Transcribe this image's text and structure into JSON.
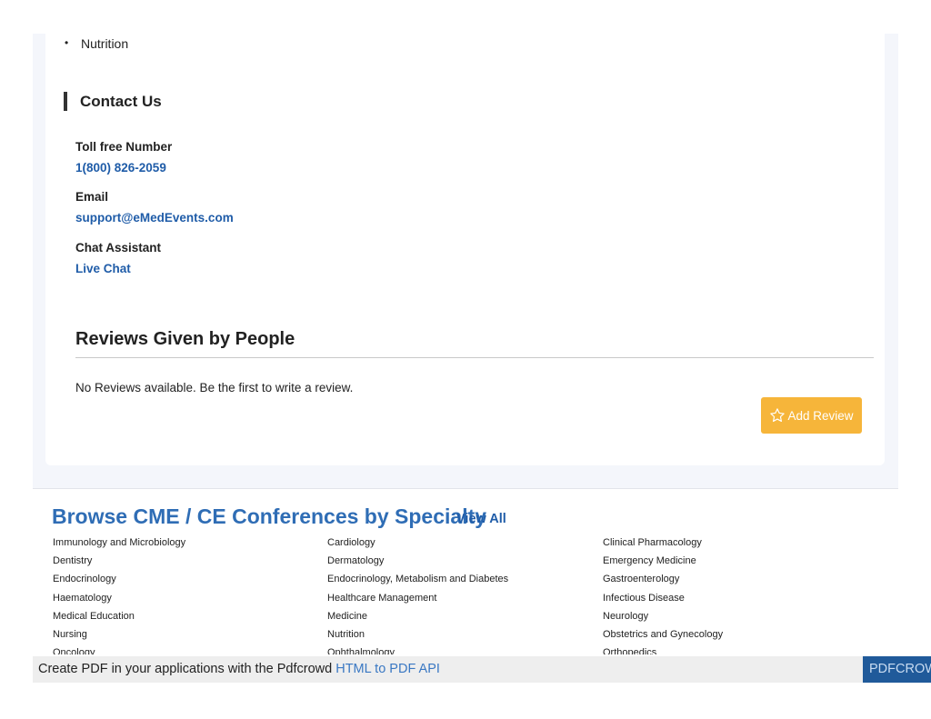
{
  "topics": {
    "items": [
      "Nutrition"
    ]
  },
  "contact": {
    "heading": "Contact Us",
    "toll_free_label": "Toll free Number",
    "toll_free_value": "1(800) 826-2059",
    "email_label": "Email",
    "email_value": "support@eMedEvents.com",
    "chat_label": "Chat Assistant",
    "chat_value": "Live Chat"
  },
  "reviews": {
    "title": "Reviews Given by People",
    "empty_text": "No Reviews available. Be the first to write a review.",
    "add_button": "Add Review"
  },
  "browse": {
    "title": "Browse CME / CE Conferences by Specialty",
    "view_all": "View All",
    "columns": [
      [
        "Immunology and Microbiology",
        "Dentistry",
        "Endocrinology",
        "Haematology",
        "Medical Education",
        "Nursing",
        "Oncology"
      ],
      [
        "Cardiology",
        "Dermatology",
        "Endocrinology, Metabolism and Diabetes",
        "Healthcare Management",
        "Medicine",
        "Nutrition",
        "Ophthalmology"
      ],
      [
        "Clinical Pharmacology",
        "Emergency Medicine",
        "Gastroenterology",
        "Infectious Disease",
        "Neurology",
        "Obstetrics and Gynecology",
        "Orthopedics"
      ]
    ]
  },
  "pdf_banner": {
    "text": "Create PDF in your applications with the Pdfcrowd ",
    "link": "HTML to PDF API",
    "brand": "PDFCROWD"
  },
  "colors": {
    "accent_blue": "#2f6db5",
    "link_blue": "#1f5ca8",
    "button_orange": "#f6b53a"
  }
}
